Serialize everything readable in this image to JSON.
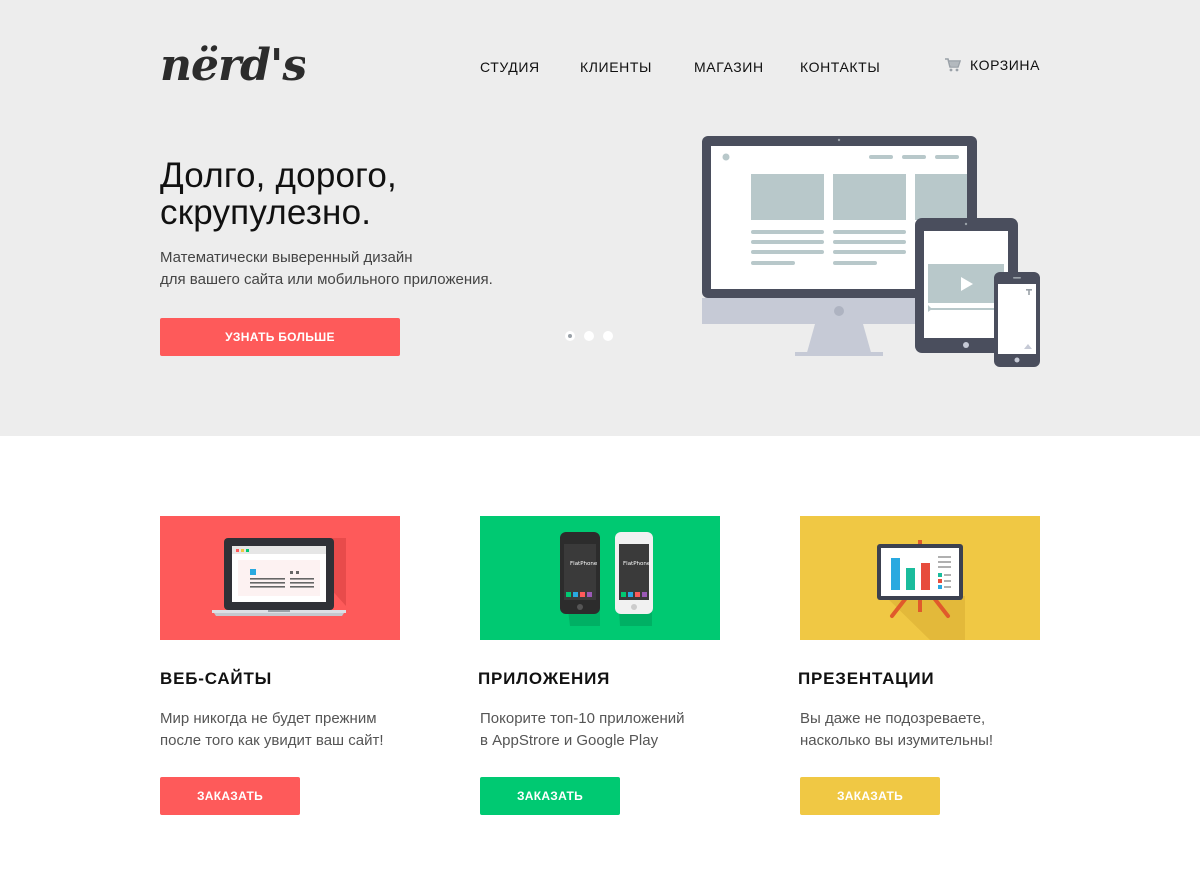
{
  "brand": {
    "logo_text": "nërd's"
  },
  "nav": {
    "items": [
      {
        "label": "СТУДИЯ"
      },
      {
        "label": "КЛИЕНТЫ"
      },
      {
        "label": "МАГАЗИН"
      },
      {
        "label": "КОНТАКТЫ"
      }
    ],
    "cart": {
      "label": "КОРЗИНА",
      "icon": "cart-icon"
    }
  },
  "hero": {
    "headline_line1": "Долго, дорого,",
    "headline_line2": "скрупулезно.",
    "subtitle_line1": "Математически выверенный дизайн",
    "subtitle_line2": "для вашего сайта или мобильного приложения.",
    "cta_label": "УЗНАТЬ БОЛЬШЕ",
    "slider": {
      "total": 3,
      "active": 1
    }
  },
  "services": [
    {
      "title": "ВЕБ-САЙТЫ",
      "text_line1": "Мир никогда не будет прежним",
      "text_line2": "после того как увидит ваш сайт!",
      "button": "ЗАКАЗАТЬ",
      "color": "#fe5a5a"
    },
    {
      "title": "ПРИЛОЖЕНИЯ",
      "text_line1": "Покорите топ-10 приложений",
      "text_line2": "в AppStrore и Google Play",
      "button": "ЗАКАЗАТЬ",
      "color": "#00c972",
      "phone_label": "FlatPhone"
    },
    {
      "title": "ПРЕЗЕНТАЦИИ",
      "text_line1": "Вы даже не подозреваете,",
      "text_line2": "насколько вы изумительны!",
      "button": "ЗАКАЗАТЬ",
      "color": "#f0c844"
    }
  ],
  "colors": {
    "hero_bg": "#ededed",
    "accent_red": "#fe5a5a",
    "accent_green": "#00c972",
    "accent_yellow": "#f0c844",
    "device_dark": "#4a4e5d",
    "placeholder": "#b8c8ca"
  }
}
